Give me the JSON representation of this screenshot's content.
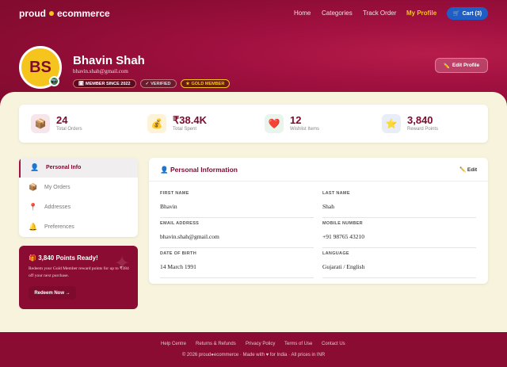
{
  "brand": {
    "part1": "proud",
    "part2": "ecommerce"
  },
  "nav": {
    "links": [
      "Home",
      "Categories",
      "Track Order",
      "My Profile"
    ],
    "cart_label": "Cart (3)",
    "cart_icon": "cart-icon"
  },
  "profile": {
    "initials": "BS",
    "name": "Bhavin Shah",
    "email": "bhavin.shah@gmail.com",
    "badges": [
      "MEMBER SINCE 2022",
      "VERIFIED",
      "GOLD MEMBER"
    ],
    "edit_label": "Edit Profile"
  },
  "stats": [
    {
      "value": "24",
      "label": "Total Orders",
      "icon": "box-icon",
      "bg": "#f6e6ec"
    },
    {
      "value": "₹38.4K",
      "label": "Total Spent",
      "icon": "money-bag-icon",
      "bg": "#fdf3d8"
    },
    {
      "value": "12",
      "label": "Wishlist Items",
      "icon": "heart-icon",
      "bg": "#e9f5ec"
    },
    {
      "value": "3,840",
      "label": "Reward Points",
      "icon": "star-icon",
      "bg": "#e8edf8"
    }
  ],
  "sidebar": {
    "items": [
      {
        "label": "Personal Info",
        "icon": "user-icon"
      },
      {
        "label": "My Orders",
        "icon": "box-icon"
      },
      {
        "label": "Addresses",
        "icon": "pin-icon"
      },
      {
        "label": "Preferences",
        "icon": "bell-icon"
      }
    ]
  },
  "promo": {
    "title": "3,840 Points Ready!",
    "text": "Redeem your Gold Member reward points for up to ₹384 off your next purchase.",
    "button": "Redeem Now →"
  },
  "panel": {
    "title": "Personal Information",
    "edit": "Edit",
    "fields": [
      {
        "label": "FIRST NAME",
        "value": "Bhavin"
      },
      {
        "label": "LAST NAME",
        "value": "Shah"
      },
      {
        "label": "EMAIL ADDRESS",
        "value": "bhavin.shah@gmail.com"
      },
      {
        "label": "MOBILE NUMBER",
        "value": "+91 98765 43210"
      },
      {
        "label": "DATE OF BIRTH",
        "value": "14 March 1991"
      },
      {
        "label": "LANGUAGE",
        "value": "Gujarati / English"
      }
    ]
  },
  "footer": {
    "links": [
      "Help Centre",
      "Returns & Refunds",
      "Privacy Policy",
      "Terms of Use",
      "Contact Us"
    ],
    "copyright": "© 2026 proud●ecommerce · Made with ♥ for India · All prices in INR"
  },
  "colors": {
    "primary": "#8a0c33",
    "accent": "#f6c51d",
    "cart": "#1f5fc5"
  }
}
